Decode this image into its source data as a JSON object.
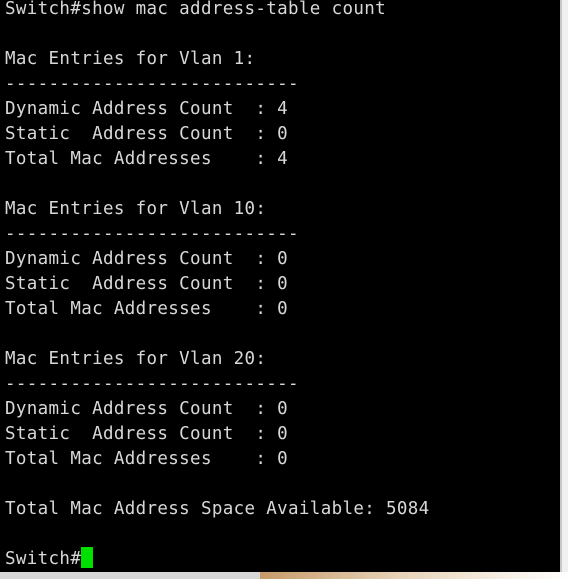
{
  "terminal": {
    "lines": [
      "Switch#show mac address-table count",
      "",
      "Mac Entries for Vlan 1:",
      "---------------------------",
      "Dynamic Address Count  : 4",
      "Static  Address Count  : 0",
      "Total Mac Addresses    : 4",
      "",
      "Mac Entries for Vlan 10:",
      "---------------------------",
      "Dynamic Address Count  : 0",
      "Static  Address Count  : 0",
      "Total Mac Addresses    : 0",
      "",
      "Mac Entries for Vlan 20:",
      "---------------------------",
      "Dynamic Address Count  : 0",
      "Static  Address Count  : 0",
      "Total Mac Addresses    : 0",
      "",
      "Total Mac Address Space Available: 5084",
      "",
      "Switch#"
    ],
    "colors": {
      "background": "#000000",
      "text": "#d8d8d8",
      "cursor": "#00e000"
    }
  }
}
